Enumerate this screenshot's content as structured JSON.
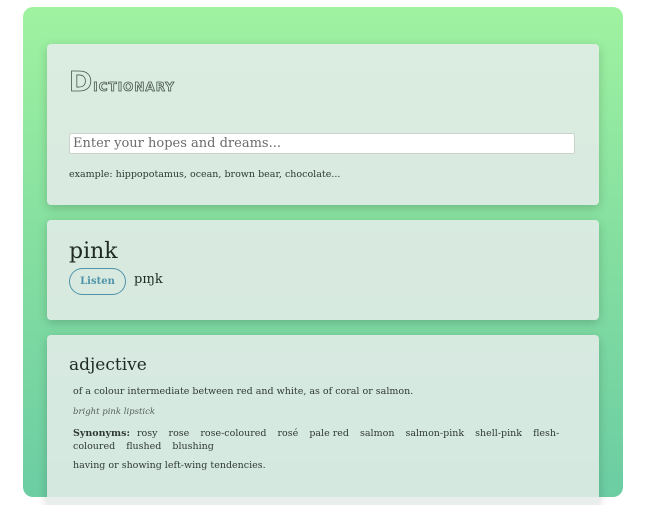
{
  "app": {
    "logo": {
      "first": "D",
      "rest": "ictionary"
    }
  },
  "search": {
    "placeholder": "Enter your hopes and dreams...",
    "example": "example: hippopotamus, ocean, brown bear, chocolate..."
  },
  "word": {
    "title": "pink",
    "listen_label": "Listen",
    "phonetic": "pɪŋk"
  },
  "meanings": [
    {
      "part_of_speech": "adjective",
      "definitions": [
        {
          "text": "of a colour intermediate between red and white, as of coral or salmon.",
          "example": "bright pink lipstick"
        },
        {
          "text": "having or showing left-wing tendencies."
        }
      ],
      "synonyms_label": "Synonyms:",
      "synonyms": [
        "rosy",
        "rose",
        "rose-coloured",
        "rosé",
        "pale red",
        "salmon",
        "salmon-pink",
        "shell-pink",
        "flesh-coloured",
        "flushed",
        "blushing"
      ]
    }
  ],
  "colors": {
    "gradient_top": "#9ff2a0",
    "gradient_bottom": "#6ccda3",
    "accent": "#4f93a8"
  }
}
